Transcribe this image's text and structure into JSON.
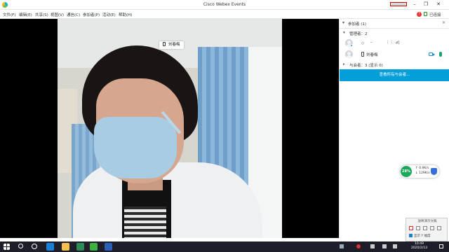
{
  "window": {
    "title": "Cisco Webex Events"
  },
  "menu": [
    {
      "label": "文件(F)"
    },
    {
      "label": "编辑(E)"
    },
    {
      "label": "共享(S)"
    },
    {
      "label": "视图(V)"
    },
    {
      "label": "通信(C)"
    },
    {
      "label": "参加者(P)"
    },
    {
      "label": "活动(E)"
    },
    {
      "label": "帮助(H)"
    }
  ],
  "status": {
    "locked_label": "已连接",
    "alert_count": "!"
  },
  "video": {
    "speaker_name": "刘春梅"
  },
  "panel": {
    "title": "参加者 (1)",
    "host_section": "管理者：2",
    "host_row": {
      "col1": "◇",
      "col2": "–",
      "col3": "⋮⋮",
      "col4": "⊿|"
    },
    "presenter_name": "刘春梅",
    "attendee_section": "与会者：3 (显示 0)",
    "view_all_button": "查看所有与会者..."
  },
  "network": {
    "percent": "28%",
    "upload": "0.9K/s",
    "download": "129K/s"
  },
  "mini_control": {
    "caption": "放映演示文稿",
    "checkbox_label": "显示 Y 幅度"
  },
  "taskbar": {
    "time": "10:49",
    "date": "2020/2/13"
  },
  "colors": {
    "accent": "#049fd9",
    "taskbar": "#1e1e2a"
  }
}
